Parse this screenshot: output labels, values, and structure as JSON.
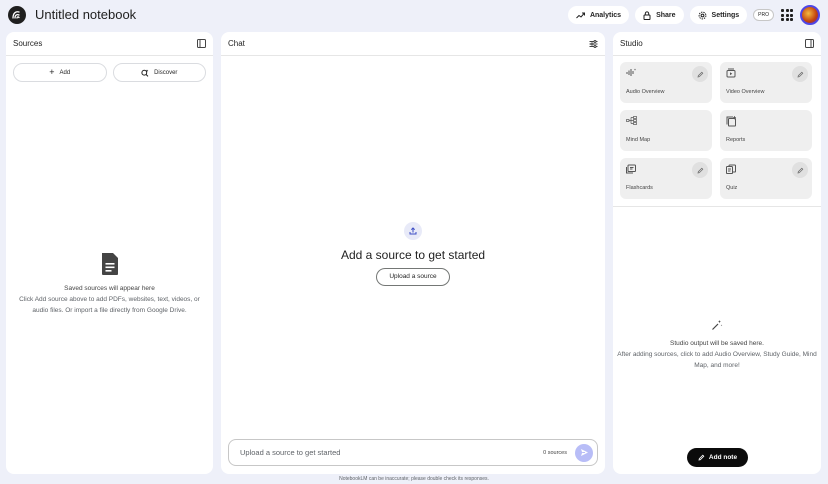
{
  "header": {
    "title": "Untitled notebook",
    "analytics_label": "Analytics",
    "share_label": "Share",
    "settings_label": "Settings",
    "pro_badge": "PRO"
  },
  "sources": {
    "title": "Sources",
    "add_label": "Add",
    "discover_label": "Discover",
    "empty_title": "Saved sources will appear here",
    "empty_body": "Click Add source above to add PDFs, websites, text, videos, or audio files. Or import a file directly from Google Drive."
  },
  "chat": {
    "title": "Chat",
    "headline": "Add a source to get started",
    "upload_label": "Upload a source",
    "input_placeholder": "Upload a source to get started",
    "source_count": "0 sources"
  },
  "studio": {
    "title": "Studio",
    "cards": [
      {
        "label": "Audio Overview",
        "icon": "audio-waveform-icon",
        "editable": true
      },
      {
        "label": "Video Overview",
        "icon": "video-icon",
        "editable": true
      },
      {
        "label": "Mind Map",
        "icon": "mind-map-icon",
        "editable": false
      },
      {
        "label": "Reports",
        "icon": "reports-icon",
        "editable": false
      },
      {
        "label": "Flashcards",
        "icon": "flashcards-icon",
        "editable": true
      },
      {
        "label": "Quiz",
        "icon": "quiz-icon",
        "editable": true
      }
    ],
    "empty_title": "Studio output will be saved here.",
    "empty_body": "After adding sources, click to add Audio Overview, Study Guide, Mind Map, and more!",
    "add_note_label": "Add note"
  },
  "footer": {
    "disclaimer": "NotebookLM can be inaccurate; please double check its responses."
  },
  "colors": {
    "background": "#eef0f9",
    "send_button": "#b8bdf7",
    "add_note_button": "#0b0b0b"
  }
}
